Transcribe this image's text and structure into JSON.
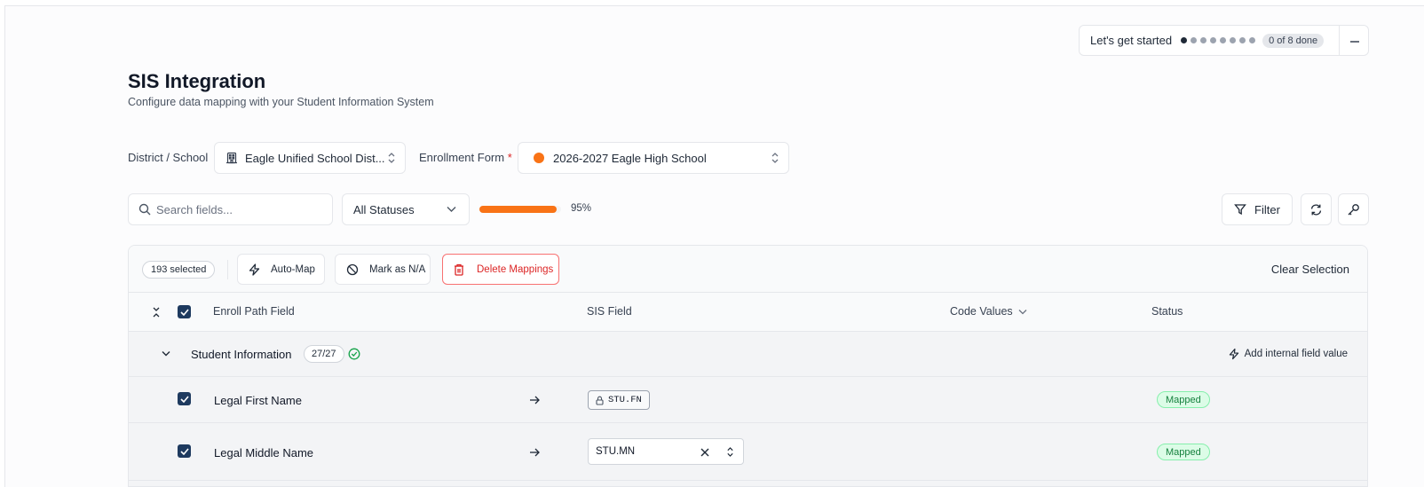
{
  "onboarding": {
    "label": "Let's get started",
    "progress_label": "0 of 8 done",
    "steps_total": 8,
    "steps_done": 0
  },
  "header": {
    "title": "SIS Integration",
    "subtitle": "Configure data mapping with your Student Information System"
  },
  "filters": {
    "district_label": "District / School",
    "district_value": "Eagle Unified School Dist...",
    "form_label": "Enrollment Form",
    "form_required_mark": "*",
    "form_value": "2026-2027 Eagle High School",
    "form_dot_color": "#f97316"
  },
  "controls": {
    "search_placeholder": "Search fields...",
    "status_select": "All Statuses",
    "progress_percent": 95,
    "progress_label": "95%",
    "filter_label": "Filter"
  },
  "bulk_toolbar": {
    "selected_label": "193 selected",
    "auto_map": "Auto-Map",
    "mark_na": "Mark as N/A",
    "delete_mappings": "Delete Mappings",
    "clear_selection": "Clear Selection"
  },
  "table": {
    "columns": {
      "enroll_field": "Enroll Path Field",
      "sis_field": "SIS Field",
      "code_values": "Code Values",
      "status": "Status"
    },
    "groups": [
      {
        "name": "Student Information",
        "count": "27/27",
        "add_internal": "Add internal field value",
        "rows": [
          {
            "label": "Legal First Name",
            "sis_field": "STU.FN",
            "locked": true,
            "status": "Mapped"
          },
          {
            "label": "Legal Middle Name",
            "sis_field": "STU.MN",
            "locked": false,
            "status": "Mapped"
          }
        ]
      }
    ]
  },
  "colors": {
    "accent": "#f97316",
    "checkbox": "#1e3a5f",
    "mapped_text": "#15803d",
    "danger": "#dc2626"
  }
}
